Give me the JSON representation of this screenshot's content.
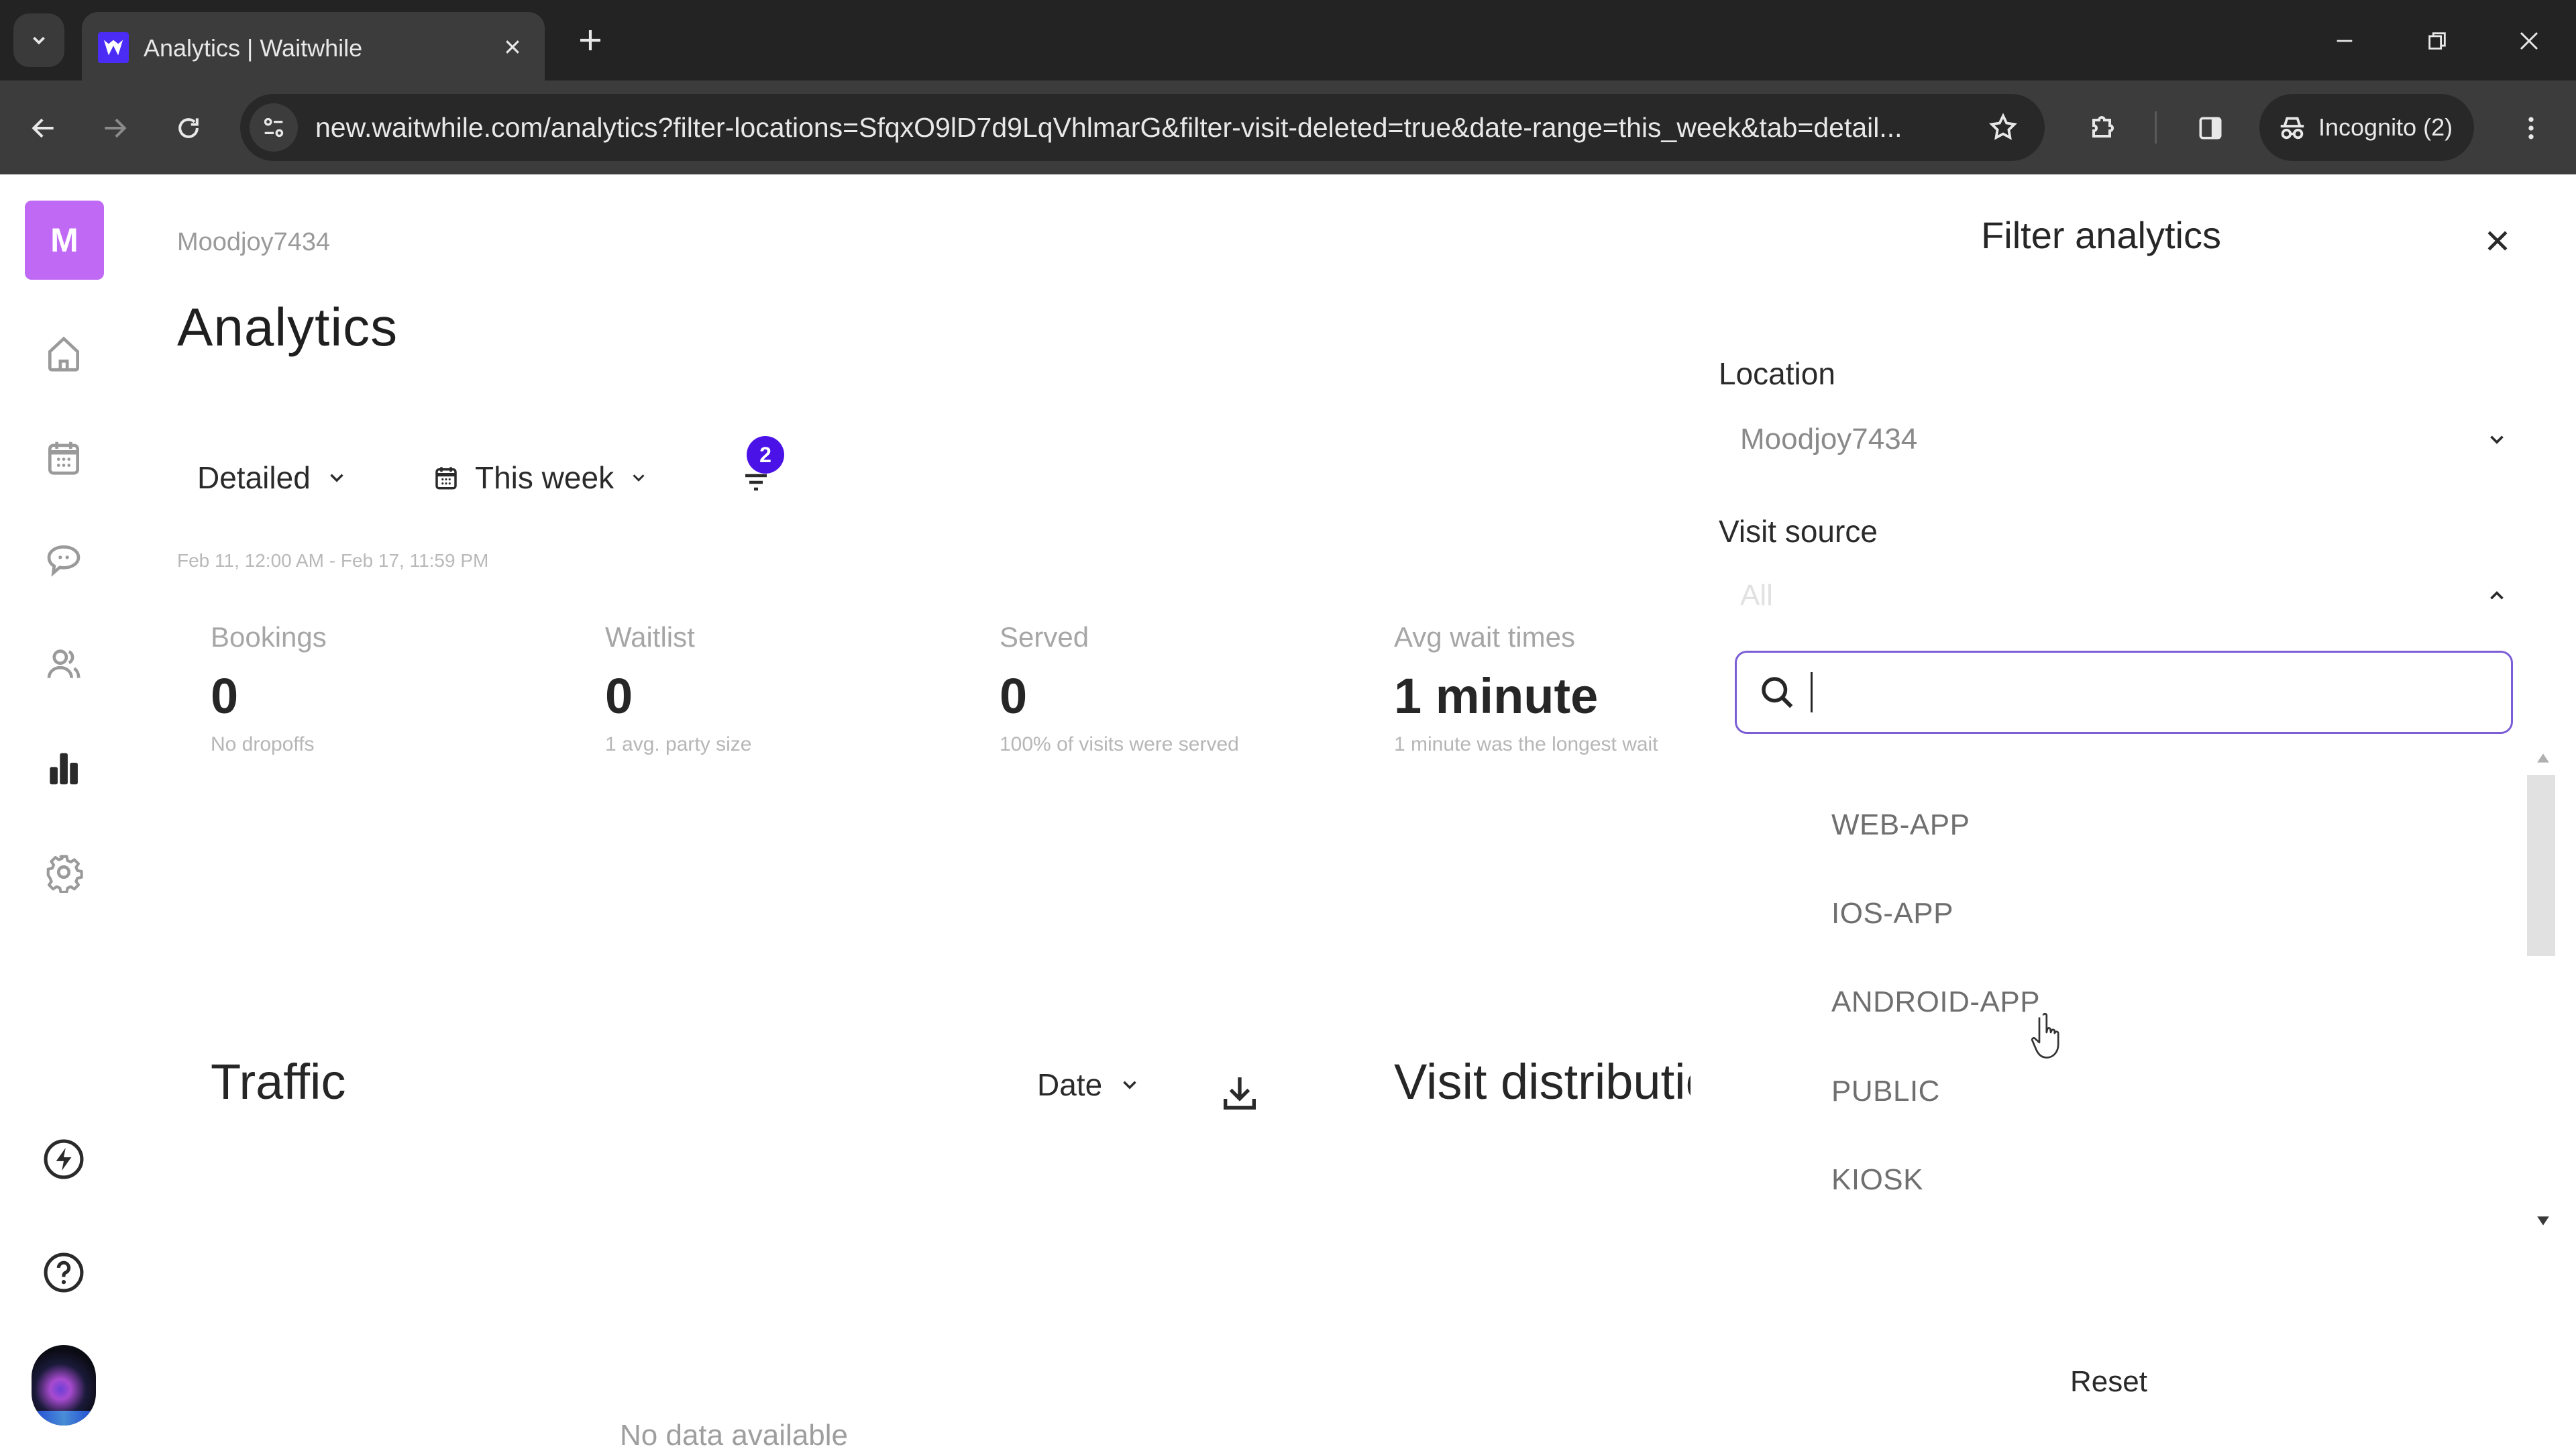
{
  "browser": {
    "tab_title": "Analytics | Waitwhile",
    "url": "new.waitwhile.com/analytics?filter-locations=SfqxO9lD7d9LqVhlmarG&filter-visit-deleted=true&date-range=this_week&tab=detail...",
    "incognito_label": "Incognito (2)",
    "favicon_letter": "W"
  },
  "sidebar": {
    "org_initial": "M",
    "items": [
      {
        "name": "home",
        "icon": "home-icon"
      },
      {
        "name": "calendar",
        "icon": "calendar-icon"
      },
      {
        "name": "messages",
        "icon": "chat-icon"
      },
      {
        "name": "customers",
        "icon": "users-icon"
      },
      {
        "name": "analytics",
        "icon": "bar-chart-icon",
        "active": true
      },
      {
        "name": "settings",
        "icon": "gear-icon"
      }
    ],
    "bottom_items": [
      {
        "name": "whats-new",
        "icon": "lightning-icon"
      },
      {
        "name": "help",
        "icon": "help-icon"
      }
    ]
  },
  "main": {
    "breadcrumb": "Moodjoy7434",
    "title": "Analytics",
    "view_select": "Detailed",
    "date_select": "This week",
    "filter_count": "2",
    "date_range_text": "Feb 11, 12:00 AM - Feb 17, 11:59 PM",
    "stats": [
      {
        "label": "Bookings",
        "value": "0",
        "sub": "No dropoffs"
      },
      {
        "label": "Waitlist",
        "value": "0",
        "sub": "1 avg. party size"
      },
      {
        "label": "Served",
        "value": "0",
        "sub": "100% of visits were served"
      },
      {
        "label": "Avg wait times",
        "value": "1 minute",
        "sub": "1 minute was the longest wait"
      }
    ],
    "traffic": {
      "title": "Traffic",
      "group_by": "Date",
      "empty_text": "No data available"
    },
    "visit_distribution_title": "Visit distribution"
  },
  "filter_panel": {
    "title": "Filter analytics",
    "location": {
      "label": "Location",
      "value": "Moodjoy7434"
    },
    "visit_source": {
      "label": "Visit source",
      "placeholder": "All",
      "search_value": "",
      "options": [
        "WEB-APP",
        "IOS-APP",
        "ANDROID-APP",
        "PUBLIC",
        "KIOSK"
      ]
    },
    "reset_label": "Reset"
  },
  "colors": {
    "accent": "#4b12e8",
    "org_avatar": "#c069f5",
    "search_focus": "#7b5ed6"
  }
}
